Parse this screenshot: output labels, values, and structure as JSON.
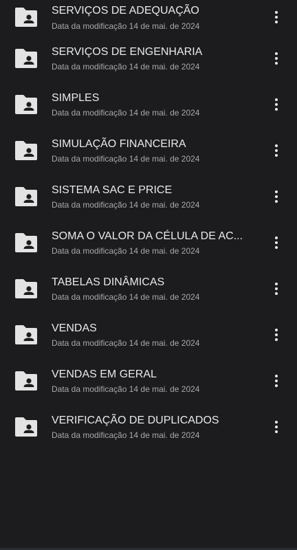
{
  "files": [
    {
      "name": "SERVIÇOS DE ADEQUAÇÃO",
      "meta": "Data da modificação 14 de mai. de 2024",
      "icon": "shared-folder-icon"
    },
    {
      "name": "SERVIÇOS DE ENGENHARIA",
      "meta": "Data da modificação 14 de mai. de 2024",
      "icon": "shared-folder-icon"
    },
    {
      "name": "SIMPLES",
      "meta": "Data da modificação 14 de mai. de 2024",
      "icon": "shared-folder-icon"
    },
    {
      "name": "SIMULAÇÃO FINANCEIRA",
      "meta": "Data da modificação 14 de mai. de 2024",
      "icon": "shared-folder-icon"
    },
    {
      "name": "SISTEMA SAC E PRICE",
      "meta": "Data da modificação 14 de mai. de 2024",
      "icon": "shared-folder-icon"
    },
    {
      "name": "SOMA O VALOR DA CÉLULA DE AC...",
      "meta": "Data da modificação 14 de mai. de 2024",
      "icon": "shared-folder-icon"
    },
    {
      "name": "TABELAS DINÂMICAS",
      "meta": "Data da modificação 14 de mai. de 2024",
      "icon": "shared-folder-icon"
    },
    {
      "name": "VENDAS",
      "meta": "Data da modificação 14 de mai. de 2024",
      "icon": "shared-folder-icon"
    },
    {
      "name": "VENDAS EM GERAL",
      "meta": "Data da modificação 14 de mai. de 2024",
      "icon": "shared-folder-icon"
    },
    {
      "name": "VERIFICAÇÃO DE DUPLICADOS",
      "meta": "Data da modificação 14 de mai. de 2024",
      "icon": "shared-folder-icon"
    }
  ],
  "colors": {
    "background": "#1c1c1e",
    "title_text": "#e8eaed",
    "meta_text": "#a8a9ad",
    "folder_icon": "#e3e3e3"
  }
}
